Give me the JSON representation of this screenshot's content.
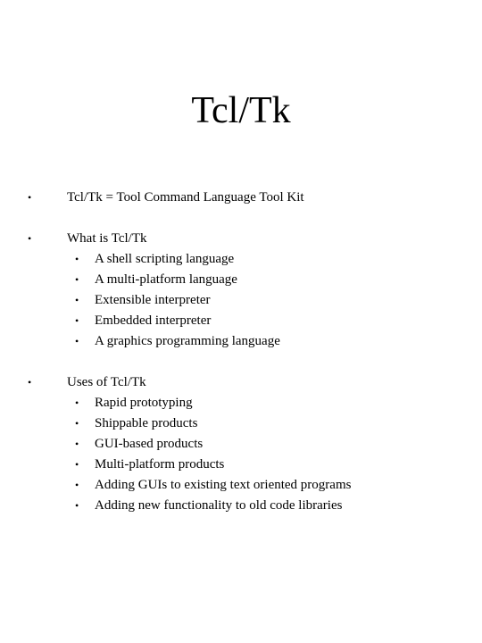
{
  "slide": {
    "title": "Tcl/Tk",
    "bullet_glyph": "•",
    "sections": [
      {
        "heading": "Tcl/Tk = Tool Command Language Tool Kit",
        "items": []
      },
      {
        "heading": "What is Tcl/Tk",
        "items": [
          "A shell scripting language",
          "A multi-platform language",
          "Extensible interpreter",
          "Embedded interpreter",
          "A graphics programming language"
        ]
      },
      {
        "heading": "Uses of Tcl/Tk",
        "items": [
          "Rapid prototyping",
          "Shippable products",
          "GUI-based products",
          "Multi-platform products",
          "Adding GUIs to existing text oriented programs",
          "Adding new functionality to old code libraries"
        ]
      }
    ]
  }
}
